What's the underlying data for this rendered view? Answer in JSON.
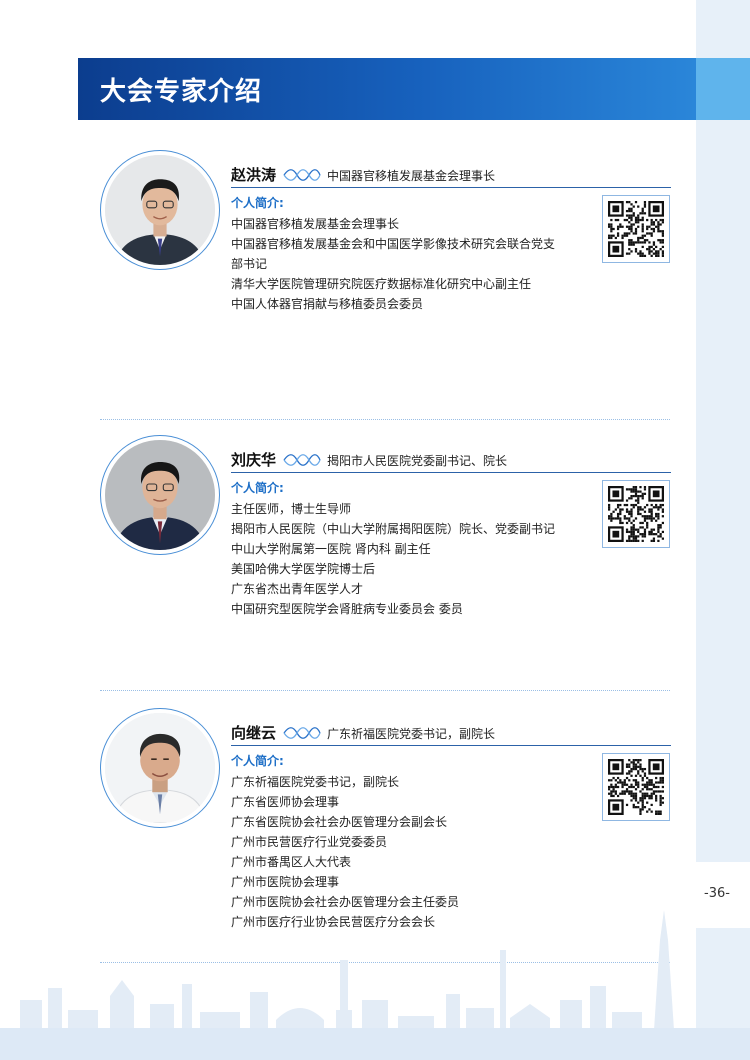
{
  "header": {
    "title": "大会专家介绍"
  },
  "page_number": "-36-",
  "intro_label": "个人简介:",
  "experts": [
    {
      "name": "赵洪涛",
      "role": "中国器官移植发展基金会理事长",
      "bio": [
        "中国器官移植发展基金会理事长",
        "中国器官移植发展基金会和中国医学影像技术研究会联合党支",
        "部书记",
        "清华大学医院管理研究院医疗数据标准化研究中心副主任",
        "中国人体器官捐献与移植委员会委员"
      ]
    },
    {
      "name": "刘庆华",
      "role": "揭阳市人民医院党委副书记、院长",
      "bio": [
        "主任医师，博士生导师",
        "揭阳市人民医院（中山大学附属揭阳医院）院长、党委副书记",
        "中山大学附属第一医院  肾内科 副主任",
        "美国哈佛大学医学院博士后",
        "广东省杰出青年医学人才",
        "中国研究型医院学会肾脏病专业委员会  委员"
      ]
    },
    {
      "name": "向继云",
      "role": "广东祈福医院党委书记，副院长",
      "bio": [
        "广东祈福医院党委书记，副院长",
        "广东省医师协会理事",
        "广东省医院协会社会办医管理分会副会长",
        "广州市民营医疗行业党委委员",
        "广州市番禺区人大代表",
        "广州市医院协会理事",
        "广州市医院协会社会办医管理分会主任委员",
        "广州市医疗行业协会民营医疗分会会长"
      ]
    }
  ],
  "colors": {
    "title_bar": "#1457b0",
    "accent": "#1e6fc7",
    "side_strip": "#e7f0f9",
    "side_tab": "#5fb4ec"
  }
}
